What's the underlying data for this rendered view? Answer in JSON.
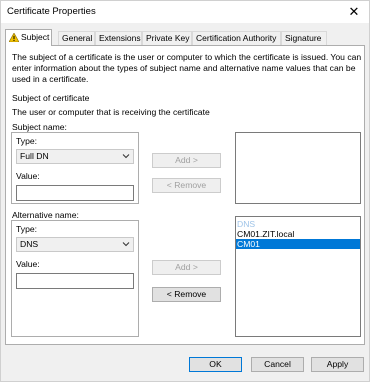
{
  "window": {
    "title": "Certificate Properties"
  },
  "tabs": [
    {
      "label": "Subject",
      "active": true,
      "icon": "warning-icon"
    },
    {
      "label": "General"
    },
    {
      "label": "Extensions"
    },
    {
      "label": "Private Key"
    },
    {
      "label": "Certification Authority"
    },
    {
      "label": "Signature"
    }
  ],
  "subject_tab": {
    "intro": "The subject of a certificate is the user or computer to which the certificate is issued. You can enter information about the types of subject name and alternative name values that can be used in a certificate.",
    "section_title": "Subject of certificate",
    "section_desc": "The user or computer that is receiving the certificate",
    "subject_name": {
      "group_label": "Subject name:",
      "type_label": "Type:",
      "type_value": "Full DN",
      "value_label": "Value:",
      "value_text": "",
      "add_label": "Add >",
      "remove_label": "< Remove",
      "list": []
    },
    "alt_name": {
      "group_label": "Alternative name:",
      "type_label": "Type:",
      "type_value": "DNS",
      "value_label": "Value:",
      "value_text": "",
      "add_label": "Add >",
      "remove_label": "< Remove",
      "list": [
        "DNS",
        "CM01.ZIT.local",
        "CM01"
      ],
      "selected_index": 2
    }
  },
  "footer": {
    "ok_label": "OK",
    "cancel_label": "Cancel",
    "apply_label": "Apply"
  },
  "colors": {
    "selection": "#0078d7",
    "warning": "#f2c200"
  }
}
